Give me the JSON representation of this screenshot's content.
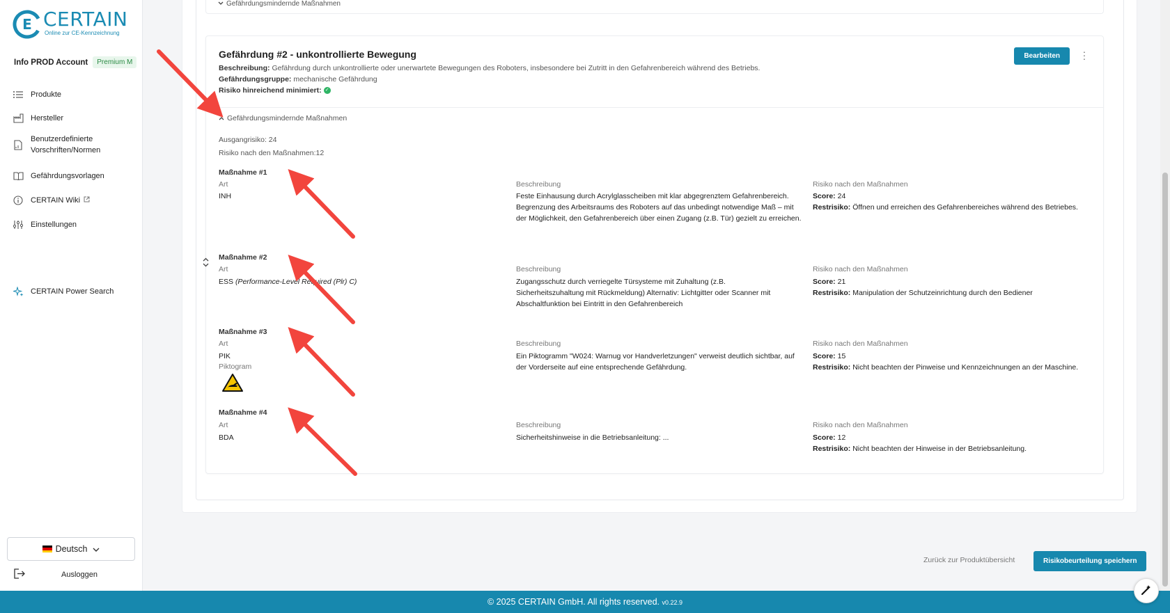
{
  "brand": {
    "name": "CERTAIN",
    "tagline": "Online zur CE-Kennzeichnung",
    "color": "#1788ae"
  },
  "account": {
    "name": "Info PROD Account",
    "plan": "Premium M"
  },
  "nav": [
    {
      "label": "Produkte",
      "icon": "list-icon"
    },
    {
      "label": "Hersteller",
      "icon": "factory-icon"
    },
    {
      "label": "Benutzerdefinierte\nVorschriften/Normen",
      "icon": "document-icon"
    },
    {
      "label": "Gefährdungsvorlagen",
      "icon": "book-icon"
    },
    {
      "label": "CERTAIN Wiki",
      "icon": "info-icon"
    },
    {
      "label": "Einstellungen",
      "icon": "sliders-icon"
    },
    {
      "label": "CERTAIN Power Search",
      "icon": "sparkle-icon"
    }
  ],
  "language": "Deutsch",
  "logout": "Ausloggen",
  "prev_hazard_toggle": "Gefährdungsmindernde Maßnahmen",
  "hazard": {
    "title": "Gefährdung #2 - unkontrollierte Bewegung",
    "description_label": "Beschreibung:",
    "description": "Gefährdung durch unkontrollierte oder unerwartete Bewegungen des Roboters, insbesondere bei Zutritt in den Gefahrenbereich während des Betriebs.",
    "group_label": "Gefährdungsgruppe:",
    "group": "mechanische Gefährdung",
    "minimized_label": "Risiko hinreichend minimiert:",
    "edit_label": "Bearbeiten",
    "mitigation_toggle": "Gefährdungsmindernde Maßnahmen",
    "initial_risk": "Ausgangrisiko: 24",
    "risk_after": "Risiko nach den Maßnahmen:12"
  },
  "labels": {
    "art": "Art",
    "desc": "Beschreibung",
    "risk": "Risiko nach den Maßnahmen",
    "pictogram": "Piktogram",
    "score": "Score:",
    "residual": "Restrisiko:"
  },
  "measures": [
    {
      "title": "Maßnahme #1",
      "art": "INH",
      "desc": "Feste Einhausung durch Acrylglasscheiben mit klar abgegrenztem Gefahrenbereich. Begrenzung des Arbeitsraums des Roboters auf das unbedingt notwendige Maß – mit der Möglichkeit, den Gefahrenbereich über einen Zugang (z.B. Tür) gezielt zu erreichen.",
      "score": "24",
      "residual": "Öffnen und erreichen des Gefahrenbereiches während des Betriebes."
    },
    {
      "title": "Maßnahme #2",
      "art": "ESS",
      "art_extra": "(Performance-Level Required (Plr) C)",
      "desc": "Zugangsschutz durch verriegelte Türsysteme mit Zuhaltung (z.B. Sicherheitszuhaltung mit Rückmeldung) Alternativ: Lichtgitter oder Scanner mit Abschaltfunktion bei Eintritt in den Gefahrenbereich",
      "score": "21",
      "residual": "Manipulation der Schutzeinrichtung durch den Bediener"
    },
    {
      "title": "Maßnahme #3",
      "art": "PIK",
      "desc": "Ein Piktogramm \"W024: Warnug vor Handverletzungen\" verweist deutlich sichtbar, auf der Vorderseite auf eine entsprechende Gefährdung.",
      "score": "15",
      "residual": "Nicht beachten der Pinweise und Kennzeichnungen an der Maschine."
    },
    {
      "title": "Maßnahme #4",
      "art": "BDA",
      "desc": "Sicherheitshinweise in die Betriebsanleitung: ...",
      "score": "12",
      "residual": "Nicht beachten der Hinweise in der Betriebsanleitung."
    }
  ],
  "actions": {
    "back": "Zurück zur Produktübersicht",
    "save": "Risikobeurteilung speichern"
  },
  "footer": {
    "text": "© 2025 CERTAIN GmbH. All rights reserved.",
    "version": "v0.22.9"
  }
}
